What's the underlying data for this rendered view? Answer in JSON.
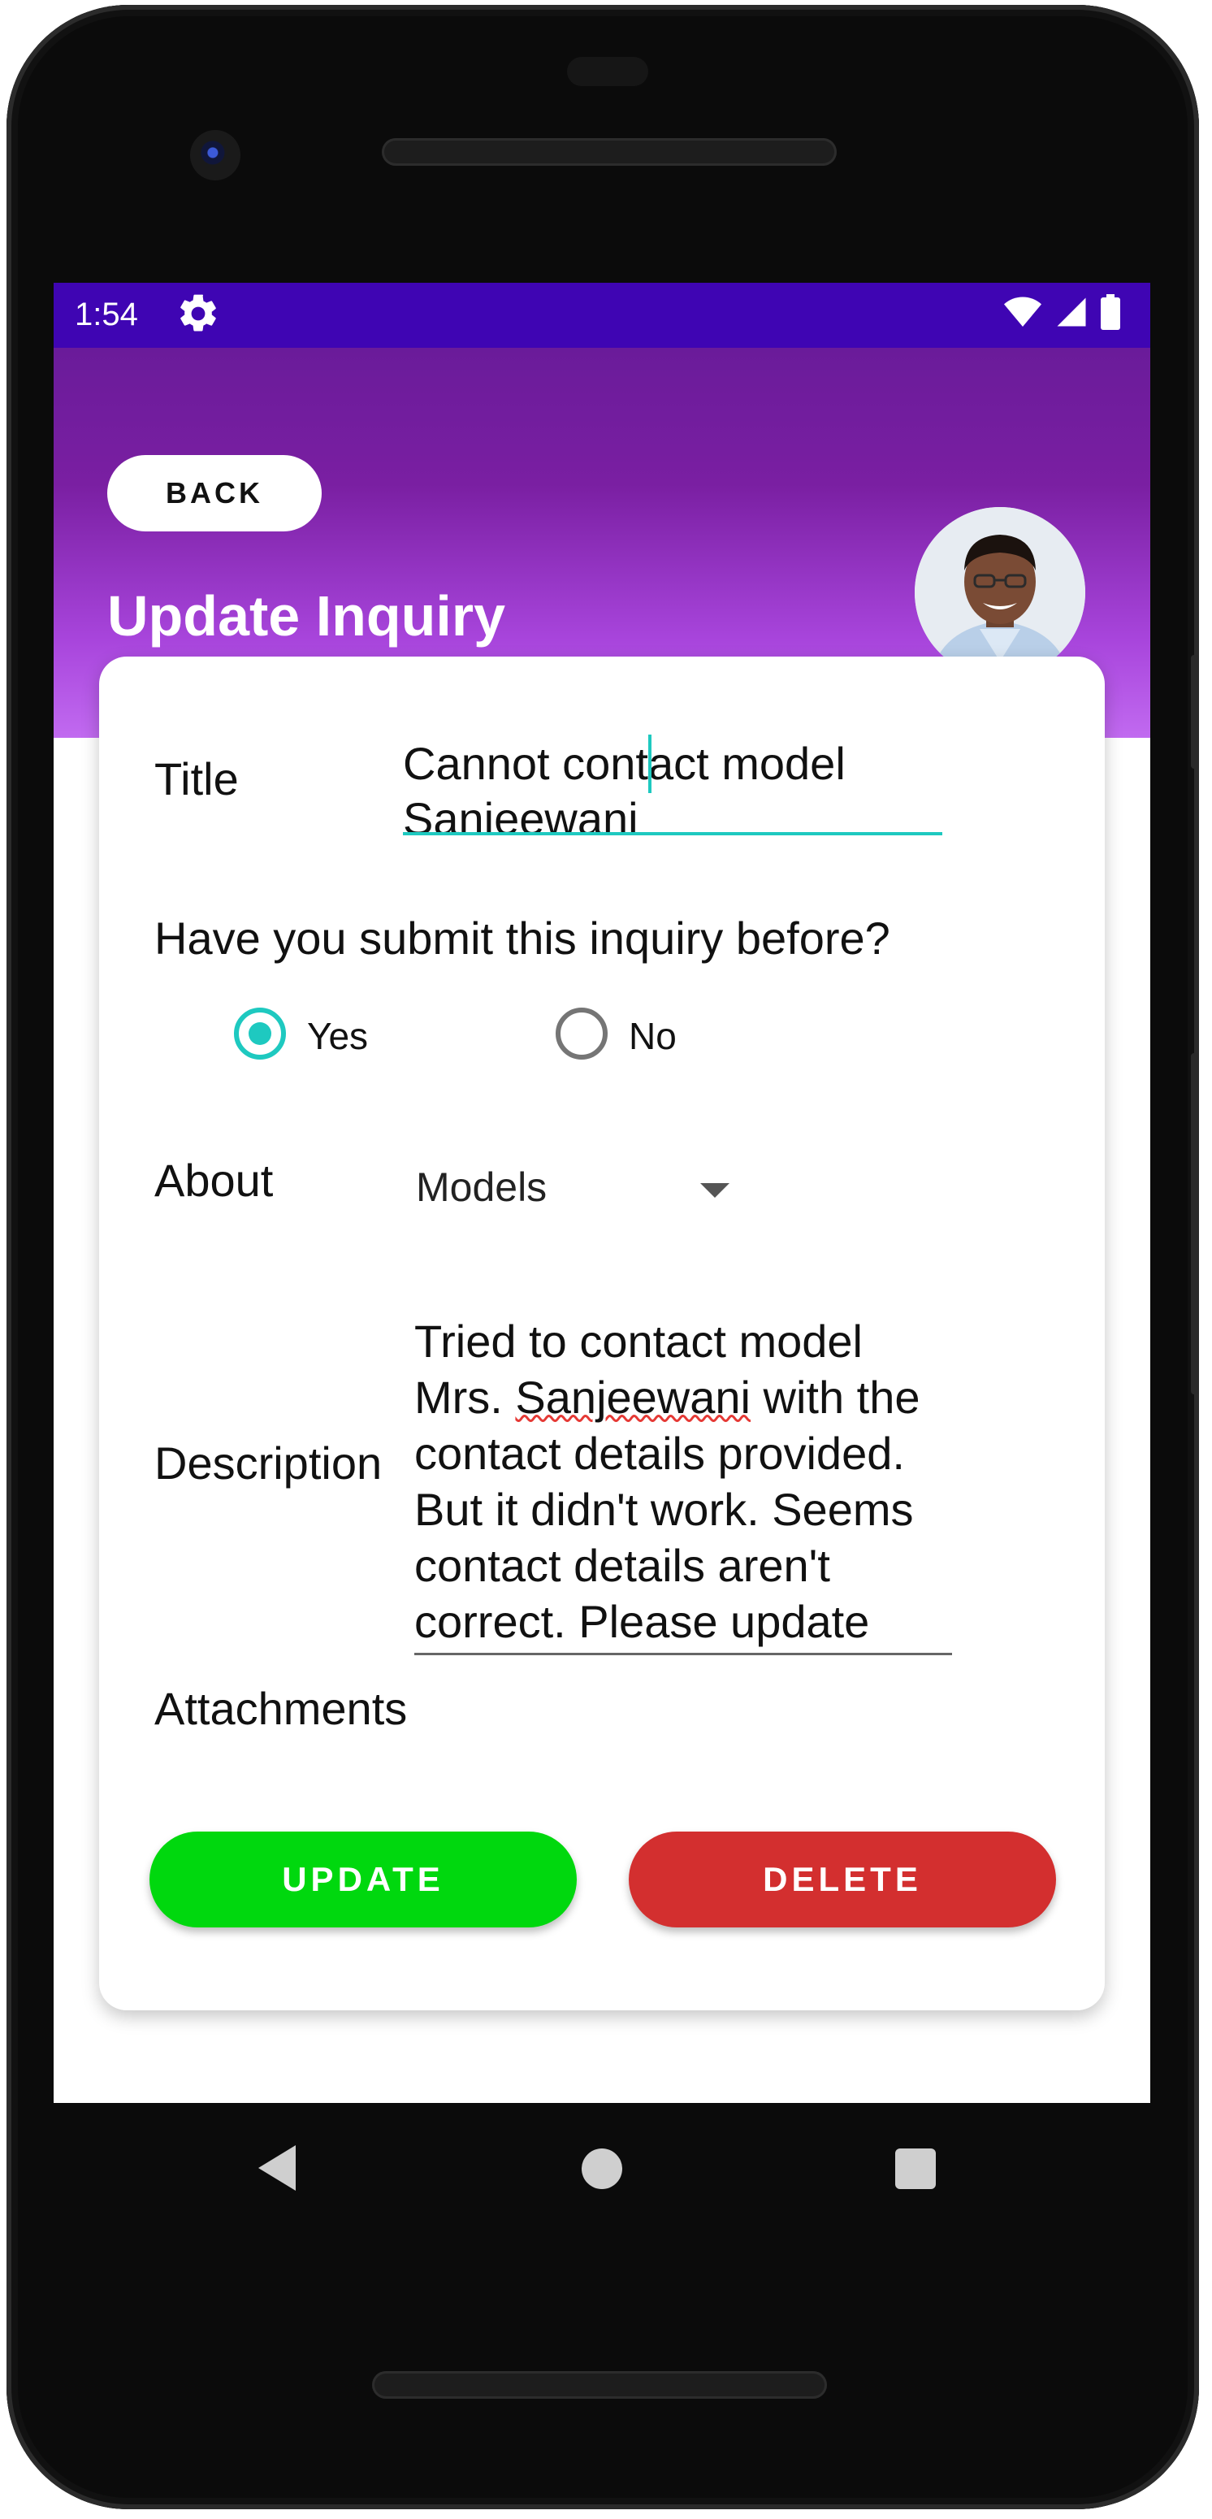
{
  "status_bar": {
    "time": "1:54",
    "icons": [
      "settings-icon",
      "wifi-icon",
      "cellular-signal-icon",
      "battery-icon"
    ],
    "background": "#3f05b3"
  },
  "header": {
    "back_label": "BACK",
    "title": "Update Inquiry",
    "gradient_top": "#6a1b9a",
    "gradient_bottom": "#c16af0"
  },
  "form": {
    "title_label": "Title",
    "title_value_line1": "Cannot contact model",
    "title_value_line2": "Sanjeewani",
    "question": "Have you submit this inquiry before?",
    "radio_yes_label": "Yes",
    "radio_no_label": "No",
    "radio_selected": "Yes",
    "about_label": "About",
    "about_value": "Models",
    "description_label": "Description",
    "description_lines": [
      "Tried to contact model",
      "Mrs. Sanjeewani with the",
      "contact details provided.",
      "But it didn't work. Seems",
      "contact details aren't",
      "correct. Please update"
    ],
    "attachments_label": "Attachments",
    "accent": "#1ec9c0"
  },
  "actions": {
    "update_label": "UPDATE",
    "update_color": "#00d80e",
    "delete_label": "DELETE",
    "delete_color": "#d32f2f"
  },
  "nav": {
    "icons": [
      "back-triangle-icon",
      "home-circle-icon",
      "recents-square-icon"
    ]
  }
}
